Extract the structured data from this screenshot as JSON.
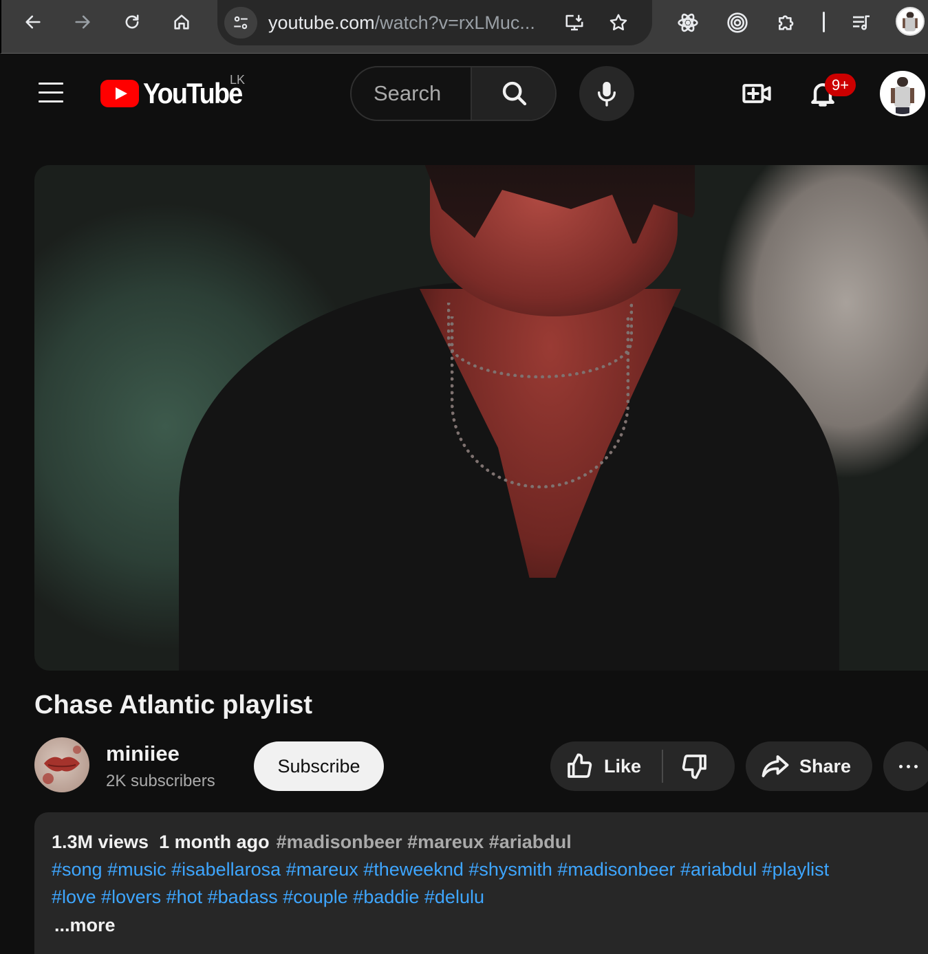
{
  "browser": {
    "url_domain": "youtube.com",
    "url_path": "/watch?v=rxLMuc..."
  },
  "masthead": {
    "logo_text": "YouTube",
    "country_code": "LK",
    "search_placeholder": "Search",
    "notification_count": "9+"
  },
  "video": {
    "title": "Chase Atlantic playlist"
  },
  "channel": {
    "name": "miniiee",
    "subscribers": "2K subscribers",
    "subscribe_label": "Subscribe"
  },
  "actions": {
    "like_label": "Like",
    "share_label": "Share"
  },
  "description": {
    "views": "1.3M views",
    "date": "1 month ago",
    "inline_tags": "#madisonbeer #mareux #ariabdul",
    "tags_line_2": "#song #music #isabellarosa #mareux #theweeknd #shysmith #madisonbeer #ariabdul #playlist",
    "tags_line_3": "#love #lovers #hot #badass #couple #baddie #delulu",
    "more_label": "...more"
  },
  "colors": {
    "background": "#0f0f0f",
    "brand_red": "#ff0000",
    "link_blue": "#3ea6ff",
    "badge_red": "#cc0000"
  }
}
